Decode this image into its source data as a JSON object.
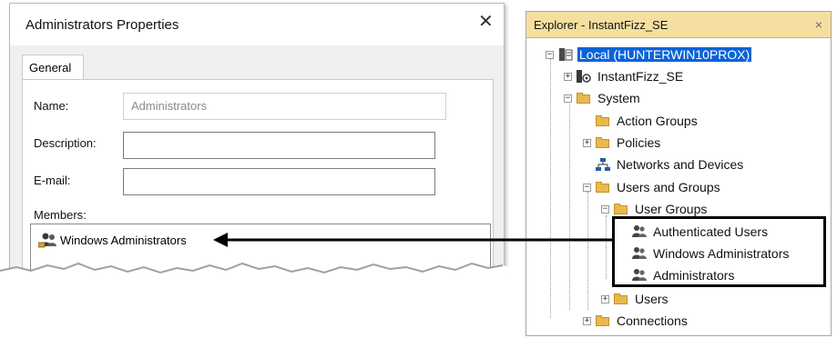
{
  "dialog": {
    "title": "Administrators Properties",
    "close_glyph": "✕",
    "tab_general": "General",
    "name_label": "Name:",
    "name_value": "Administrators",
    "description_label": "Description:",
    "description_value": "",
    "email_label": "E-mail:",
    "email_value": "",
    "members_label": "Members:",
    "members": [
      "Windows Administrators"
    ]
  },
  "explorer": {
    "title": "Explorer - InstantFizz_SE",
    "close_glyph": "×",
    "tree": {
      "root": "Local (HUNTERWIN10PROX)",
      "instantfizz": "InstantFizz_SE",
      "system": "System",
      "action_groups": "Action Groups",
      "policies": "Policies",
      "networks": "Networks and Devices",
      "users_and_groups": "Users and Groups",
      "user_groups": "User Groups",
      "authenticated_users": "Authenticated Users",
      "windows_administrators": "Windows Administrators",
      "administrators": "Administrators",
      "users": "Users",
      "connections": "Connections"
    }
  },
  "colors": {
    "selection": "#0a64d8",
    "explorer_titlebar": "#f5dfa0",
    "folder": "#e9b94b"
  }
}
